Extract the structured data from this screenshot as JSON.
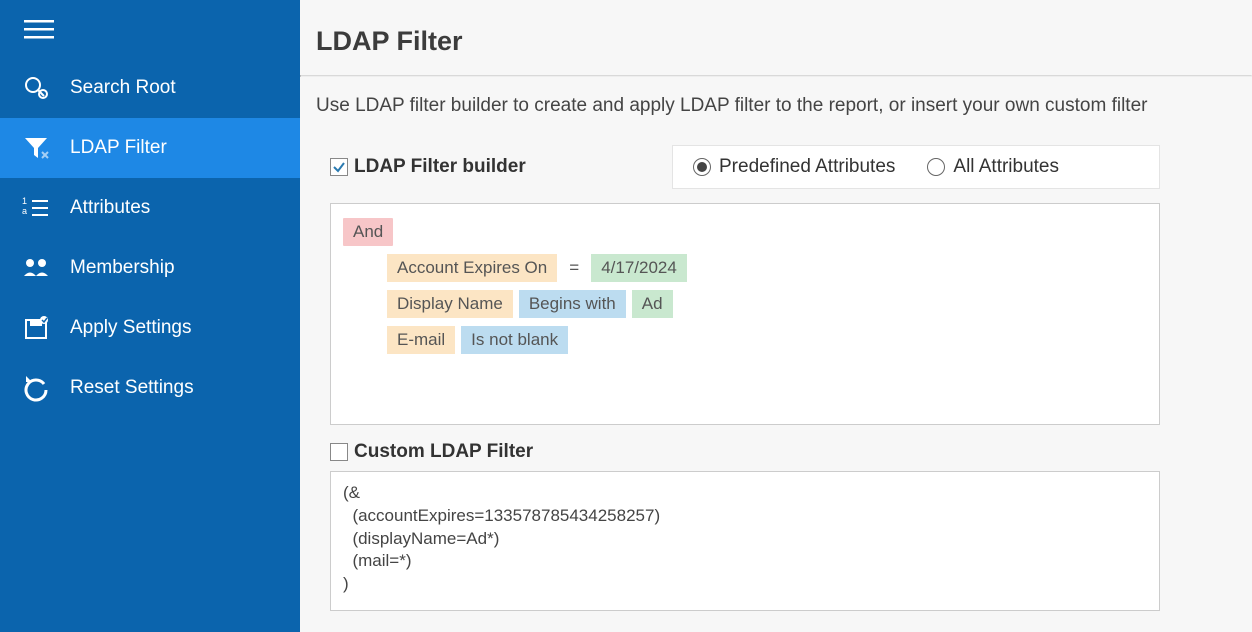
{
  "sidebar": {
    "items": [
      {
        "label": "Search Root"
      },
      {
        "label": "LDAP Filter"
      },
      {
        "label": "Attributes"
      },
      {
        "label": "Membership"
      },
      {
        "label": "Apply Settings"
      },
      {
        "label": "Reset Settings"
      }
    ]
  },
  "page": {
    "title": "LDAP Filter",
    "subtitle": "Use LDAP filter builder to create and apply LDAP filter to the report, or insert your own custom filter"
  },
  "builder": {
    "checkboxLabel": "LDAP Filter builder",
    "radioPredefined": "Predefined Attributes",
    "radioAll": "All Attributes",
    "logic": "And",
    "rules": [
      {
        "attr": "Account Expires On",
        "op": "=",
        "opStyle": "plain",
        "val": "4/17/2024"
      },
      {
        "attr": "Display Name",
        "op": "Begins with",
        "opStyle": "bg",
        "val": "Ad"
      },
      {
        "attr": "E-mail",
        "op": "Is not blank",
        "opStyle": "bg",
        "val": ""
      }
    ]
  },
  "custom": {
    "checkboxLabel": "Custom LDAP Filter",
    "text": "(&\n  (accountExpires=133578785434258257)\n  (displayName=Ad*)\n  (mail=*)\n)"
  }
}
